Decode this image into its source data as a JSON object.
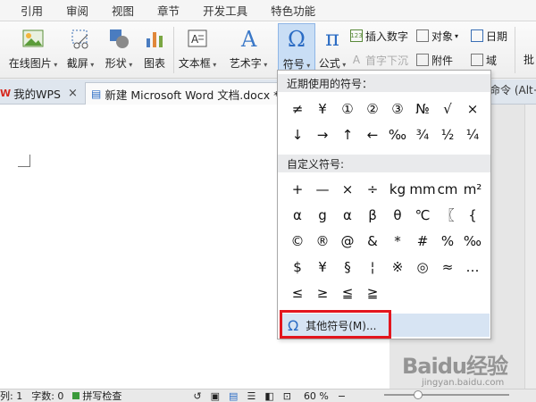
{
  "menubar": {
    "items": [
      "引用",
      "审阅",
      "视图",
      "章节",
      "开发工具",
      "特色功能"
    ]
  },
  "ribbon": {
    "online_picture": "在线图片",
    "screenshot": "截屏",
    "shapes": "形状",
    "chart": "图表",
    "textbox": "文本框",
    "wordart": "艺术字",
    "symbol": "符号",
    "formula": "公式",
    "insert_number": "插入数字",
    "object": "对象",
    "date": "日期",
    "dropcap": "首字下沉",
    "attachment": "附件",
    "field": "域",
    "batch": "批",
    "insert_number_icon_text": "123"
  },
  "tabs": {
    "wps": "我的WPS",
    "doc": "新建 Microsoft Word 文档.docx *",
    "right_cut": "命令 (Alt+"
  },
  "panel": {
    "recent_title": "近期使用的符号：",
    "recent": [
      "≠",
      "¥",
      "①",
      "②",
      "③",
      "№",
      "√",
      "×",
      "↓",
      "→",
      "↑",
      "←",
      "‰",
      "¾",
      "½",
      "¼"
    ],
    "custom_title": "自定义符号:",
    "custom": [
      "+",
      "—",
      "×",
      "÷",
      "kg",
      "mm",
      "cm",
      "m²",
      "α",
      "g",
      "α",
      "β",
      "θ",
      "℃",
      "〖",
      "{",
      "©",
      "®",
      "@",
      "&",
      "*",
      "#",
      "%",
      "‰",
      "$",
      "¥",
      "§",
      "¦",
      "※",
      "◎",
      "≈",
      "…",
      "≤",
      "≥",
      "≦",
      "≧"
    ],
    "more": "其他符号(M)..."
  },
  "status": {
    "row": "列: 1",
    "words": "字数: 0",
    "spell": "拼写检查",
    "zoom": "60 %"
  },
  "watermark": {
    "brand": "Baidu经验",
    "url": "jingyan.baidu.com"
  },
  "colors": {
    "accent": "#2b6cc4",
    "highlight": "#e3161e",
    "active_btn": "#c9def5"
  }
}
